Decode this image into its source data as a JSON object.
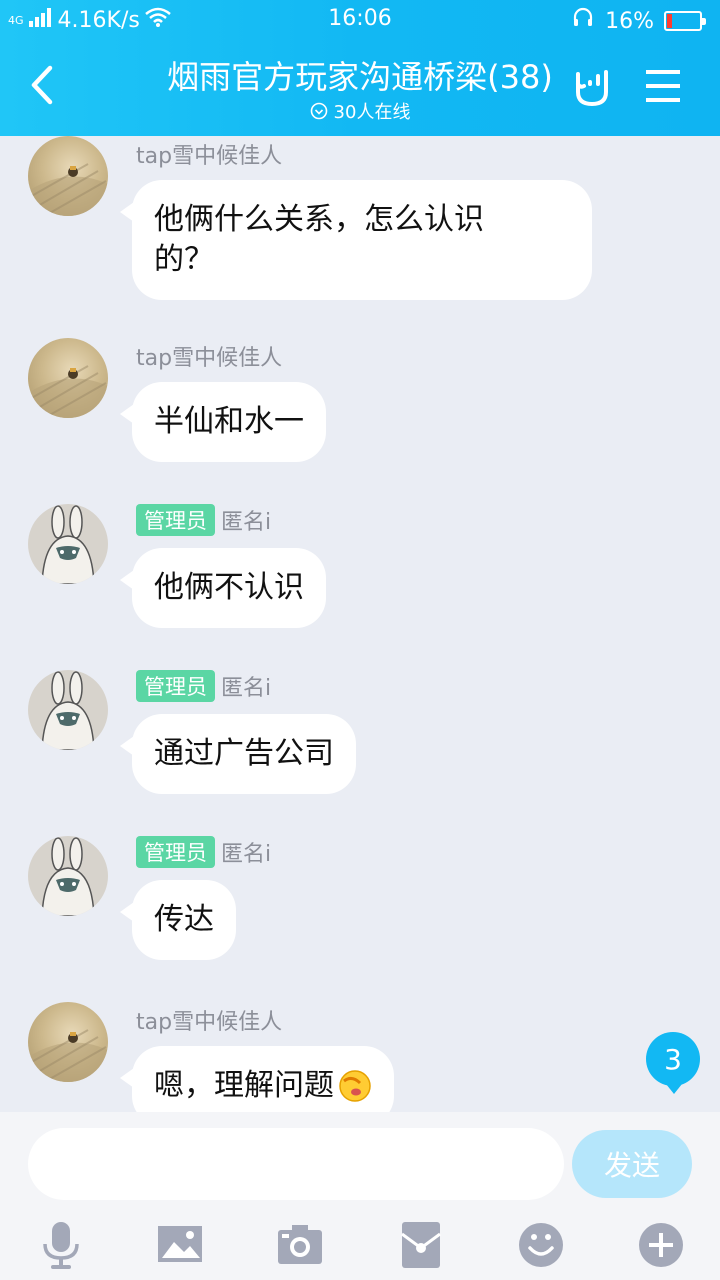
{
  "status_bar": {
    "network_type": "4G",
    "speed": "4.16K/s",
    "time": "16:06",
    "battery": "16%",
    "battery_level": 0.16
  },
  "header": {
    "title": "烟雨官方玩家沟通桥梁(38)",
    "online": "30人在线",
    "accent_color": "#12b8f3"
  },
  "messages": [
    {
      "sender": "tap雪中候佳人",
      "badge": "",
      "text": "他俩什么关系，怎么认识的？",
      "lines": [
        "他俩什么关系，怎么认识",
        "的？"
      ],
      "avatar": "photo-avatar"
    },
    {
      "sender": "tap雪中候佳人",
      "badge": "",
      "text": "半仙和水一",
      "lines": [
        "半仙和水一"
      ],
      "avatar": "photo-avatar"
    },
    {
      "sender": "匿名i",
      "badge": "管理员",
      "text": "他俩不认识",
      "lines": [
        "他俩不认识"
      ],
      "avatar": "bunny-avatar"
    },
    {
      "sender": "匿名i",
      "badge": "管理员",
      "text": "通过广告公司",
      "lines": [
        "通过广告公司"
      ],
      "avatar": "bunny-avatar"
    },
    {
      "sender": "匿名i",
      "badge": "管理员",
      "text": "传达",
      "lines": [
        "传达"
      ],
      "avatar": "bunny-avatar"
    },
    {
      "sender": "tap雪中候佳人",
      "badge": "",
      "text": "嗯，理解问题",
      "lines": [
        "嗯，理解问题"
      ],
      "avatar": "photo-avatar",
      "emoji": "facepalm-emoji"
    }
  ],
  "unread_count": "3",
  "input": {
    "value": "",
    "placeholder": "",
    "send_label": "发送"
  },
  "toolbar": [
    "mic-icon",
    "image-icon",
    "camera-icon",
    "red-packet-icon",
    "emoji-icon",
    "plus-icon"
  ]
}
